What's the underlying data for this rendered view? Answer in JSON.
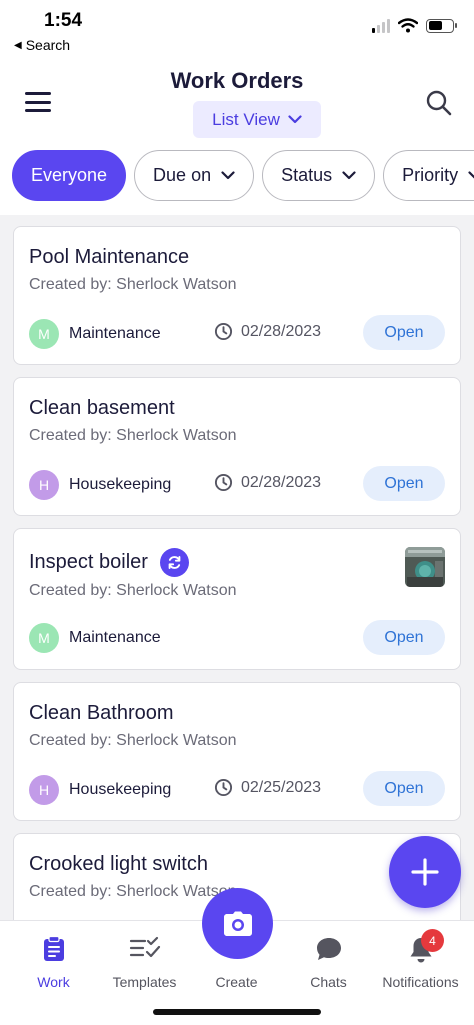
{
  "status_bar": {
    "time": "1:54",
    "back_label": "Search"
  },
  "header": {
    "title": "Work Orders",
    "view_toggle_label": "List View"
  },
  "filters": [
    {
      "label": "Everyone",
      "active": true,
      "has_dropdown": false
    },
    {
      "label": "Due on",
      "active": false,
      "has_dropdown": true
    },
    {
      "label": "Status",
      "active": false,
      "has_dropdown": true
    },
    {
      "label": "Priority",
      "active": false,
      "has_dropdown": true
    }
  ],
  "work_orders": [
    {
      "title": "Pool Maintenance",
      "created_by": "Created by: Sherlock Watson",
      "category_initial": "M",
      "category": "Maintenance",
      "category_color": "#9be6b4",
      "due_date": "02/28/2023",
      "status": "Open",
      "recurring": false,
      "has_thumbnail": false
    },
    {
      "title": "Clean basement",
      "created_by": "Created by: Sherlock Watson",
      "category_initial": "H",
      "category": "Housekeeping",
      "category_color": "#c29be8",
      "due_date": "02/28/2023",
      "status": "Open",
      "recurring": false,
      "has_thumbnail": false
    },
    {
      "title": "Inspect boiler",
      "created_by": "Created by: Sherlock Watson",
      "category_initial": "M",
      "category": "Maintenance",
      "category_color": "#9be6b4",
      "due_date": "",
      "status": "Open",
      "recurring": true,
      "has_thumbnail": true
    },
    {
      "title": "Clean Bathroom",
      "created_by": "Created by: Sherlock Watson",
      "category_initial": "H",
      "category": "Housekeeping",
      "category_color": "#c29be8",
      "due_date": "02/25/2023",
      "status": "Open",
      "recurring": false,
      "has_thumbnail": false
    },
    {
      "title": "Crooked light switch",
      "created_by": "Created by: Sherlock Watson",
      "category_initial": "",
      "category": "",
      "category_color": "",
      "due_date": "",
      "status": "",
      "recurring": false,
      "has_thumbnail": false
    }
  ],
  "tabbar": {
    "tabs": [
      {
        "label": "Work",
        "icon": "clipboard-icon",
        "active": true
      },
      {
        "label": "Templates",
        "icon": "checklist-icon",
        "active": false
      },
      {
        "label": "Create",
        "icon": "camera-icon",
        "active": false
      },
      {
        "label": "Chats",
        "icon": "chat-bubble-icon",
        "active": false
      },
      {
        "label": "Notifications",
        "icon": "bell-icon",
        "active": false
      }
    ],
    "notification_count": "4"
  },
  "colors": {
    "accent": "#5a46f0",
    "badge_bg": "#e5eefc",
    "badge_text": "#2f73d6",
    "notification": "#e5393d"
  }
}
